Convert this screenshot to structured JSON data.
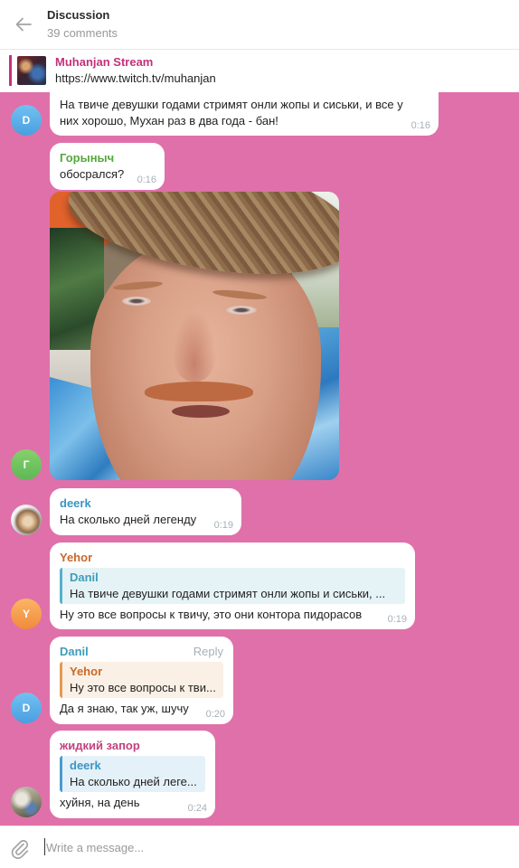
{
  "header": {
    "title": "Discussion",
    "subtitle": "39 comments"
  },
  "pinned": {
    "title": "Muhanjan Stream",
    "text": "https://www.twitch.tv/muhanjan"
  },
  "messages": [
    {
      "avatar_letter": "D",
      "text_lines": [
        "На твиче девушки годами стримят онли жопы и сиськи, и все у",
        "них хорошо, Мухан раз в два года - бан!"
      ],
      "time": "0:16"
    },
    {
      "author": "Горыныч",
      "avatar_letter": "Г",
      "text": "обосрался?",
      "time": "0:16"
    },
    {
      "author": "deerk",
      "text": "На сколько дней легенду",
      "time": "0:19"
    },
    {
      "author": "Yehor",
      "avatar_letter": "Y",
      "reply": {
        "author": "Danil",
        "text": "На твиче девушки годами стримят онли жопы и сиськи, ..."
      },
      "text": "Ну это все вопросы к твичу, это они контора пидорасов",
      "time": "0:19"
    },
    {
      "author": "Danil",
      "avatar_letter": "D",
      "action": "Reply",
      "reply": {
        "author": "Yehor",
        "text": "Ну это все вопросы к тви..."
      },
      "text": "Да я знаю, так уж, шучу",
      "time": "0:20"
    },
    {
      "author": "жидкий запор",
      "reply": {
        "author": "deerk",
        "text": "На сколько дней леге..."
      },
      "text": "хуйня, на день",
      "time": "0:24"
    }
  ],
  "composer": {
    "placeholder": "Write a message..."
  },
  "icons": {
    "back": "back-arrow-icon",
    "attach": "paperclip-icon"
  },
  "colors": {
    "chat-bg": "#e070aa",
    "accent": "#c4317b",
    "time": "#a7b0b8",
    "name-gorynych": "#55a83c",
    "name-deerk": "#3a95c3",
    "name-yehor": "#c8692a",
    "name-danil": "#3e9dbb",
    "name-zhidkiy": "#c2417e",
    "reply-danil-bg": "#e6f3f6",
    "reply-danil-border": "#57b0cb",
    "reply-yehor-bg": "#fbf0e5",
    "reply-yehor-border": "#e39a55",
    "reply-deerk-bg": "#e5f1f8",
    "reply-deerk-border": "#4b9ad0"
  }
}
